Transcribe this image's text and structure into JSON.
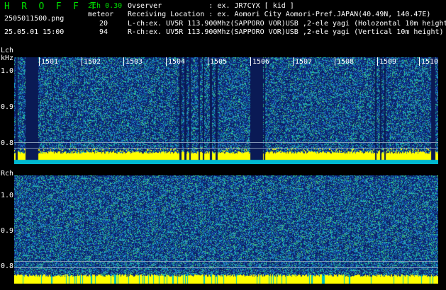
{
  "header": {
    "title": "H R O F F T",
    "mode": "2ch 0.30",
    "meteor_label": "meteor",
    "count_l": "20",
    "count_r": "94",
    "filename": "2505011500.png",
    "timestamp": "25.05.01 15:00",
    "observer": "Ovserver           : ex. JR7CYX [ kid ]",
    "location": "Receiving Location : ex. Aomori City Aomori-Pref.JAPAN(40.49N, 140.47E)",
    "lch_info": "L-ch:ex. UV5R 113.900Mhz(SAPPORO VOR)USB ,2-ele yagi (Holozontal 10m height",
    "rch_info": "R-ch:ex. UV5R 113.900Mhz(SAPPORO VOR)USB ,2-ele yagi (Vertical 10m height)"
  },
  "lch": {
    "label": "Lch",
    "unit": "kHz",
    "y_ticks": [
      "1.0",
      "0.9",
      "0.8"
    ],
    "hour_labels": [
      "1501",
      "1502",
      "1503",
      "1504",
      "1505",
      "1506",
      "1507",
      "1508",
      "1509",
      "1510"
    ]
  },
  "rch": {
    "label": "Rch",
    "y_ticks": [
      "1.0",
      "0.9",
      "0.8"
    ]
  },
  "colors": {
    "header_green": "#00e000",
    "signal_yellow": "#ffff00",
    "noise_blue": "#0b1f66",
    "noise_cyan": "#00c0c0"
  }
}
